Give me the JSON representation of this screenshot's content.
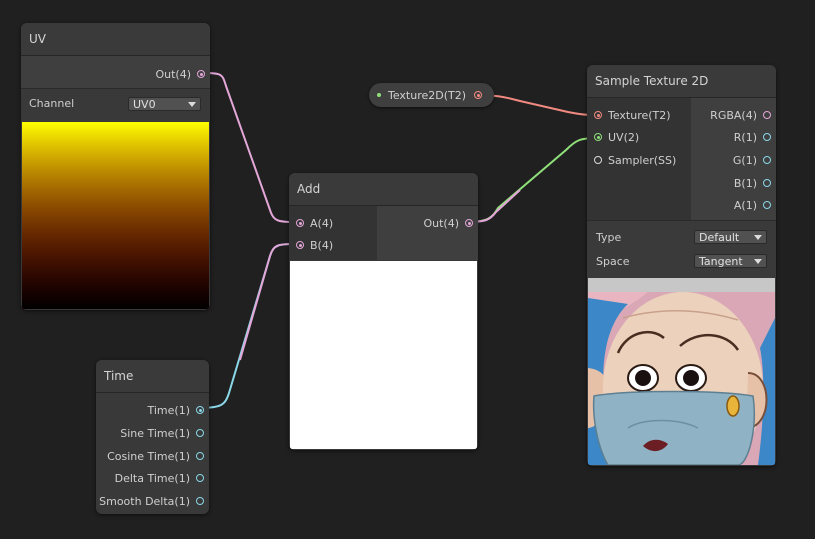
{
  "colors": {
    "background": "#202020",
    "node": "#393939",
    "vector4": "#e3a6d8",
    "vector1": "#8ad8e8",
    "vector2": "#8fe07a",
    "texture": "#f08a80"
  },
  "uv_node": {
    "title": "UV",
    "out_label": "Out(4)",
    "channel_label": "Channel",
    "channel_value": "UV0"
  },
  "time_node": {
    "title": "Time",
    "outputs": [
      "Time(1)",
      "Sine Time(1)",
      "Cosine Time(1)",
      "Delta Time(1)",
      "Smooth Delta(1)"
    ]
  },
  "add_node": {
    "title": "Add",
    "input_a": "A(4)",
    "input_b": "B(4)",
    "out_label": "Out(4)"
  },
  "texture_property": {
    "label": "Texture2D(T2)"
  },
  "sample_node": {
    "title": "Sample Texture 2D",
    "inputs": [
      "Texture(T2)",
      "UV(2)",
      "Sampler(SS)"
    ],
    "outputs": [
      "RGBA(4)",
      "R(1)",
      "G(1)",
      "B(1)",
      "A(1)"
    ],
    "type_label": "Type",
    "type_value": "Default",
    "space_label": "Space",
    "space_value": "Tangent"
  }
}
